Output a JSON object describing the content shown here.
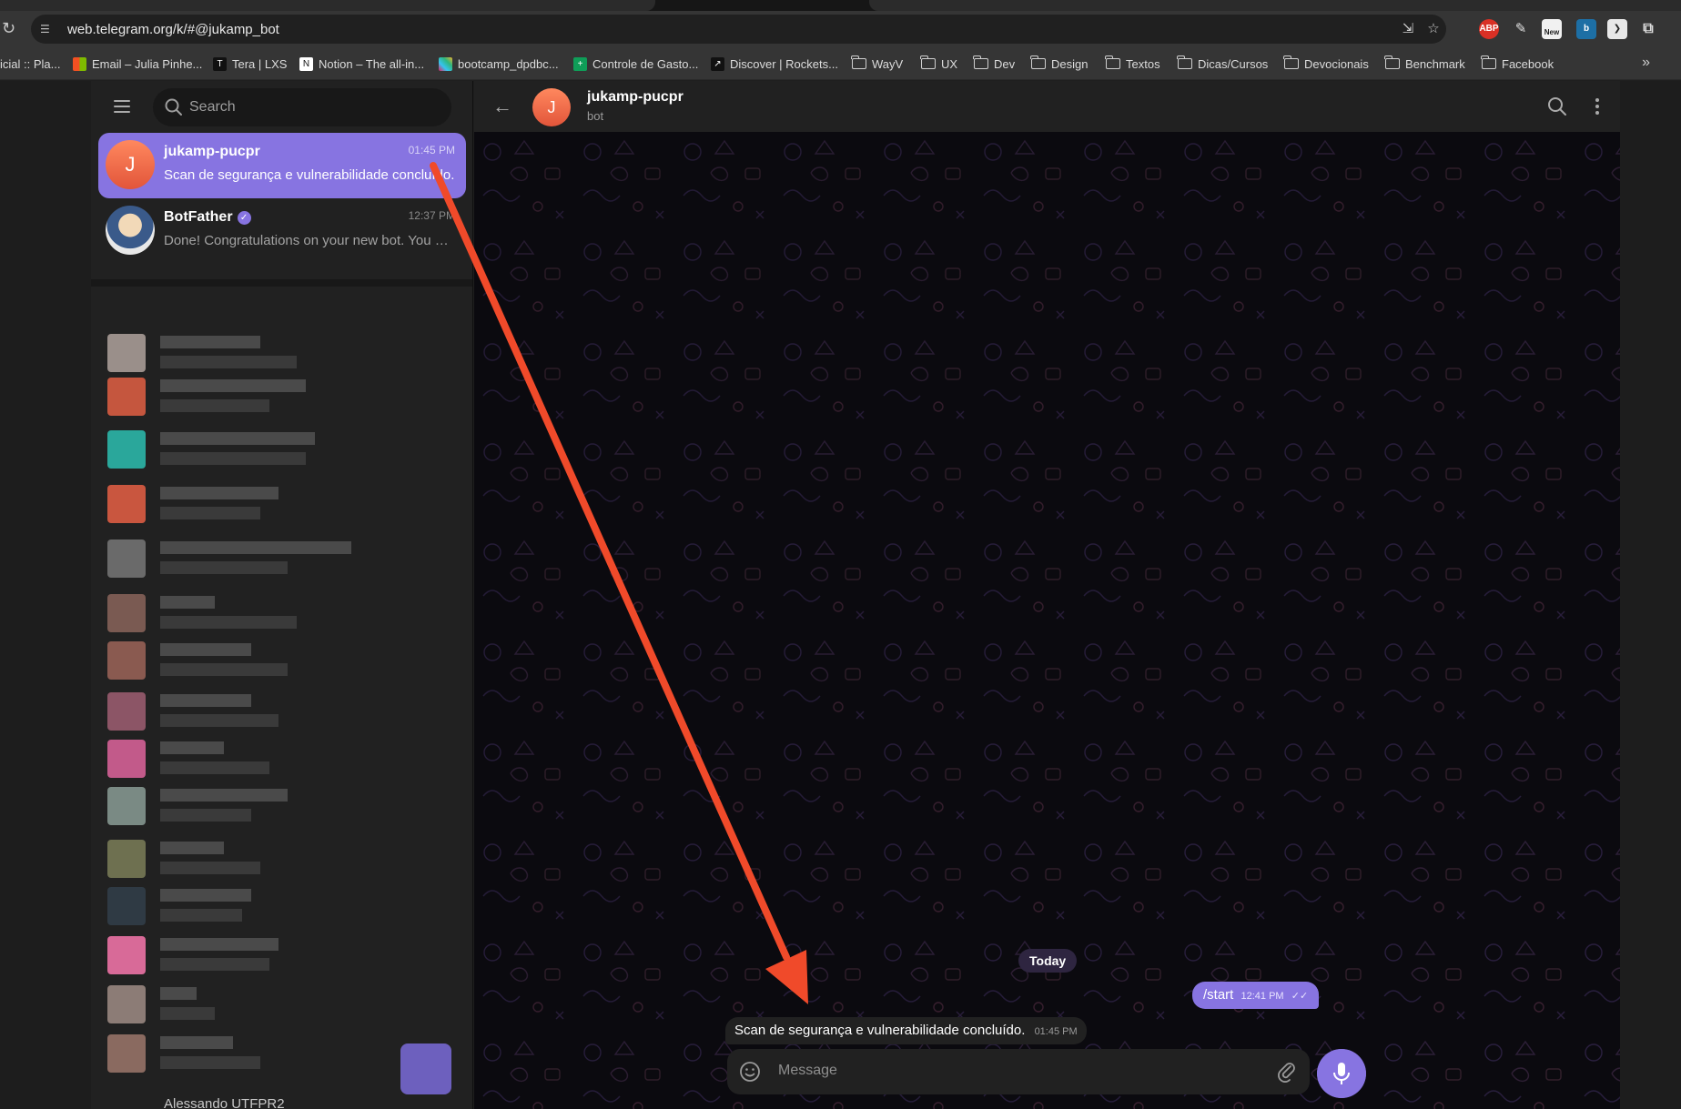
{
  "browser": {
    "url": "web.telegram.org/k/#@jukamp_bot",
    "extensions": [
      "ABP",
      "New"
    ],
    "bookmarks": [
      {
        "label": "icial :: Pla...",
        "icon": "page-icon"
      },
      {
        "label": "Email – Julia Pinhe...",
        "icon": "microsoft-icon"
      },
      {
        "label": "Tera | LXS",
        "icon": "tera-icon"
      },
      {
        "label": "Notion – The all-in...",
        "icon": "notion-icon"
      },
      {
        "label": "bootcamp_dpdbc...",
        "icon": "slack-icon"
      },
      {
        "label": "Controle de Gasto...",
        "icon": "sheets-icon"
      },
      {
        "label": "Discover | Rockets...",
        "icon": "rocketseat-icon"
      },
      {
        "label": "WayV",
        "icon": "folder-icon"
      },
      {
        "label": "UX",
        "icon": "folder-icon"
      },
      {
        "label": "Dev",
        "icon": "folder-icon"
      },
      {
        "label": "Design",
        "icon": "folder-icon"
      },
      {
        "label": "Textos",
        "icon": "folder-icon"
      },
      {
        "label": "Dicas/Cursos",
        "icon": "folder-icon"
      },
      {
        "label": "Devocionais",
        "icon": "folder-icon"
      },
      {
        "label": "Benchmark",
        "icon": "folder-icon"
      },
      {
        "label": "Facebook",
        "icon": "folder-icon"
      }
    ],
    "more": "»"
  },
  "sidebar": {
    "search_placeholder": "Search",
    "chats": [
      {
        "name": "jukamp-pucpr",
        "time": "01:45 PM",
        "preview": "Scan de segurança e vulnerabilidade concluído.",
        "avatar_letter": "J",
        "active": true
      },
      {
        "name": "BotFather",
        "time": "12:37 PM",
        "preview": "Done! Congratulations on your new bot. You will find it at t.me/jukamp_bot.",
        "verified": true,
        "active": false
      }
    ],
    "cut_off_name": "Alessando UTFPR2"
  },
  "chat": {
    "title": "jukamp-pucpr",
    "status": "bot",
    "avatar_letter": "J",
    "date_separator": "Today",
    "messages": [
      {
        "direction": "out",
        "text": "/start",
        "time": "12:41 PM",
        "read": true
      },
      {
        "direction": "in",
        "text": "Scan de segurança e vulnerabilidade concluído.",
        "time": "01:45 PM"
      }
    ],
    "composer_placeholder": "Message"
  },
  "colors": {
    "accent": "#8774e1",
    "annotation_arrow": "#f04a2a",
    "avatar": "#ef6a47",
    "background": "#0b0a0f",
    "panel": "#212121"
  }
}
